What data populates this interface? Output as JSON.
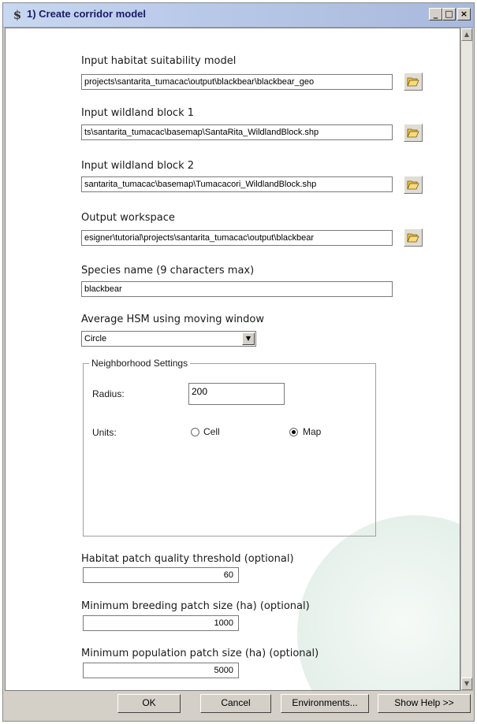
{
  "window": {
    "title": "1) Create corridor model",
    "app_icon": "$",
    "controls": {
      "minimize": "_",
      "maximize": "□",
      "close": "×"
    }
  },
  "form": {
    "habitat_model": {
      "label": "Input habitat suitability model",
      "value": "projects\\santarita_tumacac\\output\\blackbear\\blackbear_geo"
    },
    "wildland_block_1": {
      "label": "Input wildland block 1",
      "value": "ts\\santarita_tumacac\\basemap\\SantaRita_WildlandBlock.shp"
    },
    "wildland_block_2": {
      "label": "Input wildland block 2",
      "value": "santarita_tumacac\\basemap\\Tumacacori_WildlandBlock.shp"
    },
    "output_workspace": {
      "label": "Output workspace",
      "value": "esigner\\tutorial\\projects\\santarita_tumacac\\output\\blackbear"
    },
    "species_name": {
      "label": "Species name (9 characters max)",
      "value": "blackbear"
    },
    "average_hsm": {
      "label": "Average HSM using moving window",
      "value": "Circle"
    },
    "neighborhood": {
      "legend": "Neighborhood Settings",
      "radius_label": "Radius:",
      "radius_value": "200",
      "units_label": "Units:",
      "option_cell": "Cell",
      "option_map": "Map",
      "selected": "Map"
    },
    "quality_threshold": {
      "label": "Habitat patch quality threshold (optional)",
      "value": "60"
    },
    "min_breeding": {
      "label": "Minimum breeding patch size (ha) (optional)",
      "value": "1000"
    },
    "min_population": {
      "label": "Minimum population patch size (ha) (optional)",
      "value": "5000"
    }
  },
  "buttons": {
    "ok": "OK",
    "cancel": "Cancel",
    "environments": "Environments...",
    "show_help": "Show Help >>"
  },
  "icons": {
    "browse": "folder-open-icon",
    "dropdown": "chevron-down-icon"
  }
}
